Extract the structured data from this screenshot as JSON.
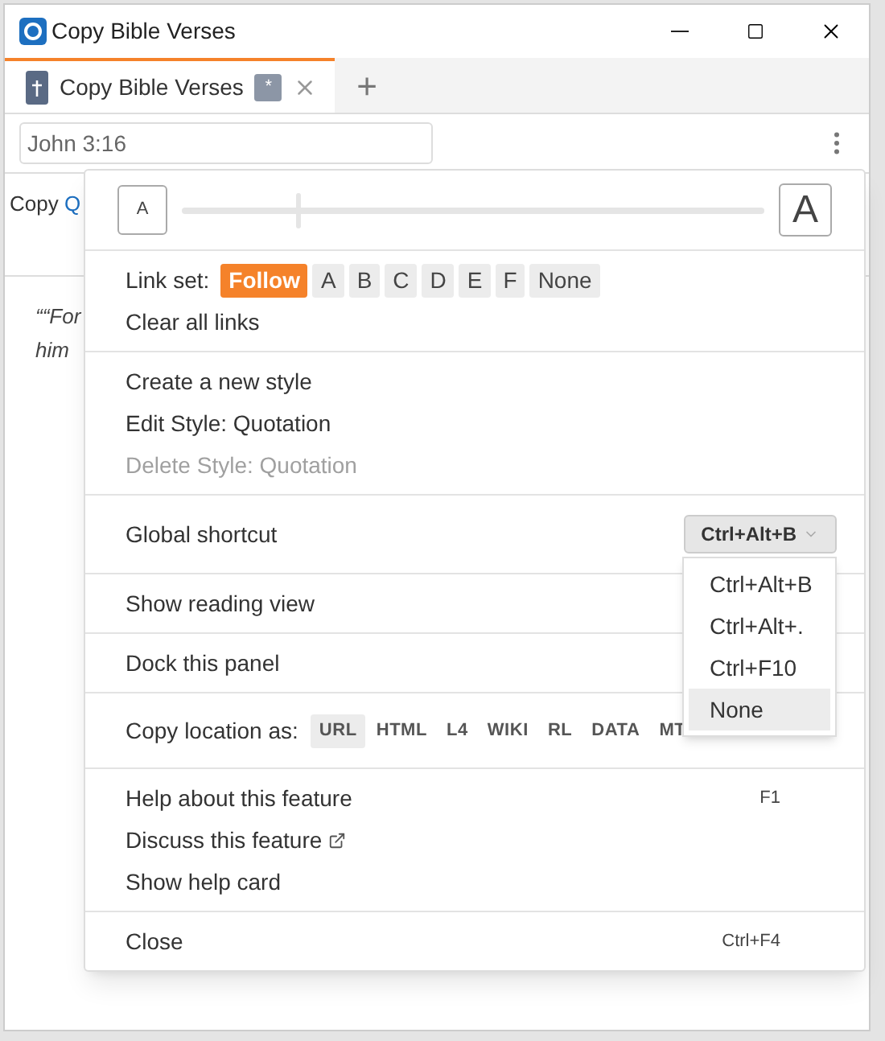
{
  "window": {
    "title": "Copy Bible Verses"
  },
  "tabs": [
    {
      "label": "Copy Bible Verses",
      "badge": "*",
      "selected": true
    }
  ],
  "new_tab": "+",
  "reference_field": {
    "value": "John 3:16"
  },
  "background": {
    "copy_label": "Copy",
    "link": "Q",
    "quote_lines": [
      "““For",
      "him"
    ]
  },
  "menu": {
    "font_size_slider": {
      "small_label": "A",
      "large_label": "A",
      "level": 0.2
    },
    "sections": [
      [
        {
          "kind": "chips",
          "label": "Link set:",
          "options": [
            {
              "label": "Follow",
              "selected": true
            },
            {
              "label": "A",
              "selected": false
            },
            {
              "label": "B",
              "selected": false
            },
            {
              "label": "C",
              "selected": false
            },
            {
              "label": "D",
              "selected": false
            },
            {
              "label": "E",
              "selected": false
            },
            {
              "label": "F",
              "selected": false
            },
            {
              "label": "None",
              "selected": false
            }
          ]
        },
        {
          "kind": "action",
          "label": "Clear all links",
          "disabled": false
        }
      ],
      [
        {
          "kind": "action",
          "label": "Create a new style",
          "disabled": false
        },
        {
          "kind": "action",
          "label": "Edit Style: Quotation",
          "disabled": false
        },
        {
          "kind": "action",
          "label": "Delete Style: Quotation",
          "disabled": true
        }
      ],
      [
        {
          "kind": "select",
          "label": "Global shortcut",
          "value": "Ctrl+Alt+B",
          "expanded": true,
          "options": [
            {
              "label": "Ctrl+Alt+B",
              "highlighted": false
            },
            {
              "label": "Ctrl+Alt+.",
              "highlighted": false
            },
            {
              "label": "Ctrl+F10",
              "highlighted": false
            },
            {
              "label": "None",
              "highlighted": true
            }
          ]
        }
      ],
      [
        {
          "kind": "action",
          "label": "Show reading view",
          "disabled": false
        }
      ],
      [
        {
          "kind": "action",
          "label": "Dock this panel",
          "disabled": false
        }
      ],
      [
        {
          "kind": "formats",
          "label": "Copy location as:",
          "options": [
            {
              "label": "URL",
              "selected": true
            },
            {
              "label": "HTML",
              "selected": false
            },
            {
              "label": "L4",
              "selected": false
            },
            {
              "label": "WIKI",
              "selected": false
            },
            {
              "label": "RL",
              "selected": false
            },
            {
              "label": "DATA",
              "selected": false
            },
            {
              "label": "MT",
              "selected": false
            }
          ]
        }
      ],
      [
        {
          "kind": "action",
          "label": "Help about this feature",
          "disabled": false,
          "shortcut": "F1"
        },
        {
          "kind": "action",
          "label": "Discuss this feature",
          "disabled": false,
          "external": true
        },
        {
          "kind": "action",
          "label": "Show help card",
          "disabled": false
        }
      ],
      [
        {
          "kind": "action",
          "label": "Close",
          "disabled": false,
          "shortcut": "Ctrl+F4"
        }
      ]
    ]
  }
}
